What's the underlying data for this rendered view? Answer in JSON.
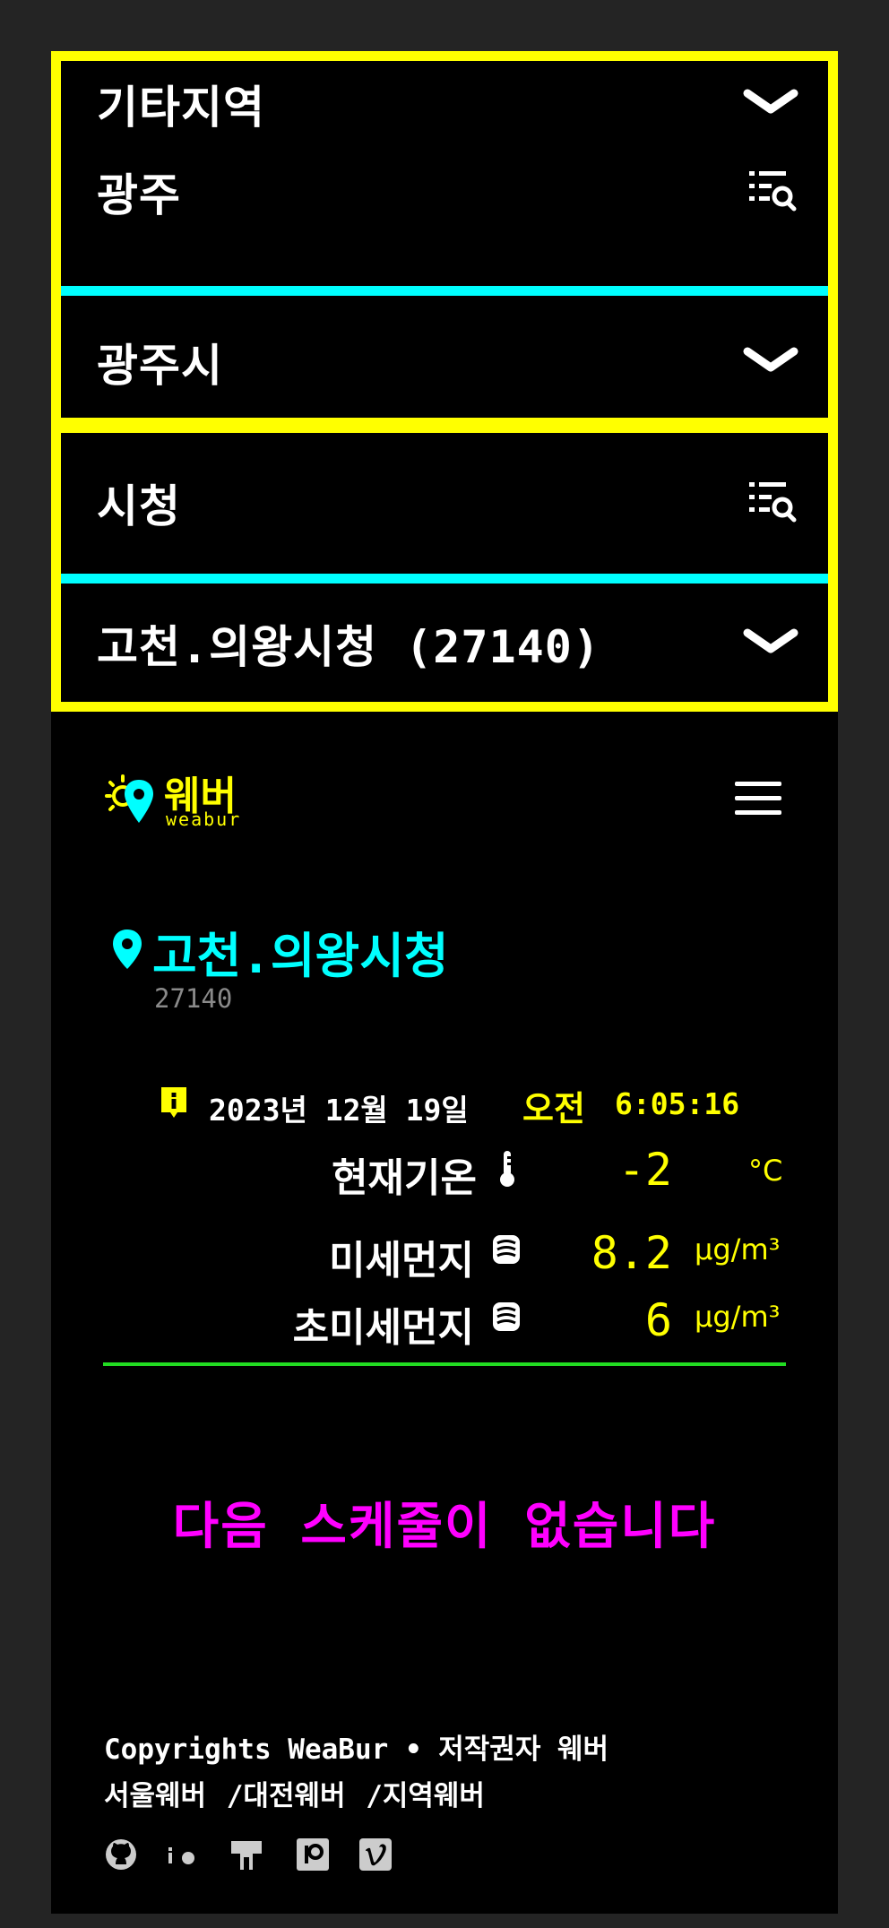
{
  "selectors": {
    "region": "기타지역",
    "city": "광주",
    "district": "광주시",
    "office": "시청",
    "station": "고천.의왕시청 (27140)"
  },
  "header": {
    "logo_text": "웨버",
    "logo_subtext": "weabur"
  },
  "location": {
    "name": "고천.의왕시청",
    "code": "27140"
  },
  "datetime": {
    "date": "2023년 12월 19일",
    "ampm": "오전",
    "time": "6:05:16"
  },
  "metrics": {
    "temperature": {
      "label": "현재기온",
      "value": "-2",
      "unit": "°C"
    },
    "pm10": {
      "label": "미세먼지",
      "value": "8.2",
      "unit": "μg/m³"
    },
    "pm25": {
      "label": "초미세먼지",
      "value": "6",
      "unit": "μg/m³"
    }
  },
  "schedule": {
    "empty_message": "다음 스케줄이 없습니다"
  },
  "footer": {
    "copyright": "Copyrights WeaBur • 저작권자 웨버",
    "links": [
      "서울웨버",
      "/대전웨버",
      "/지역웨버"
    ],
    "social_icons": [
      "github-icon",
      "io-icon",
      "gitea-icon",
      "patreon-icon",
      "vimeo-icon"
    ]
  },
  "colors": {
    "accent_yellow": "#ffff00",
    "accent_cyan": "#00ffff",
    "accent_magenta": "#ff00ff",
    "divider_green": "#22dd22",
    "background": "#000000"
  }
}
